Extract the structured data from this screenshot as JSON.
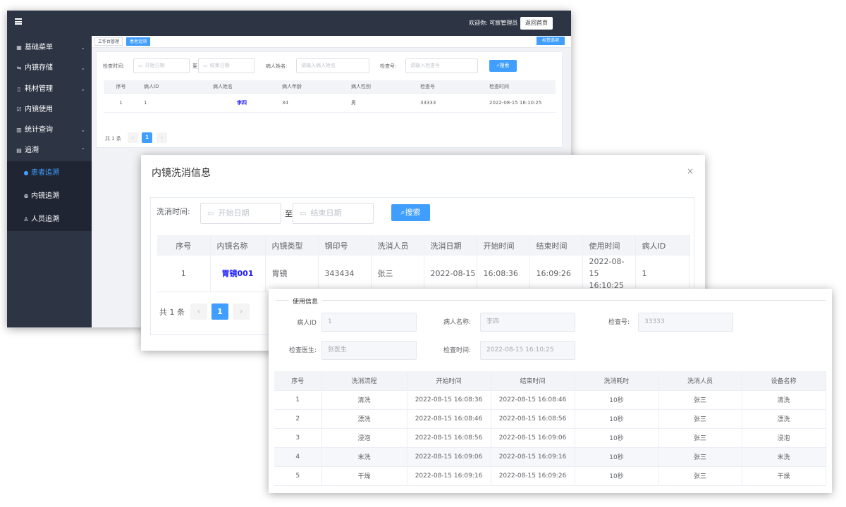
{
  "app": {
    "welcome": "欢迎你:  可宸管理员",
    "home_button": "返回首页",
    "sidebar": {
      "items": [
        {
          "label": "基础菜单",
          "icon": "grid-icon",
          "glyph": "▦",
          "chevron": "⌄"
        },
        {
          "label": "内镜存储",
          "icon": "swap-icon",
          "glyph": "⇋",
          "chevron": "⌄"
        },
        {
          "label": "耗材管理",
          "icon": "document-icon",
          "glyph": "▯",
          "chevron": "⌄"
        },
        {
          "label": "内镜使用",
          "icon": "checkbox-icon",
          "glyph": "☑",
          "chevron": ""
        },
        {
          "label": "统计查询",
          "icon": "bar-chart-icon",
          "glyph": "▥",
          "chevron": "⌄"
        },
        {
          "label": "追溯",
          "icon": "trace-icon",
          "glyph": "▤",
          "chevron": "⌃"
        }
      ],
      "sub_items": [
        {
          "label": "患者追溯",
          "icon": "person-icon",
          "glyph": "●",
          "active": true
        },
        {
          "label": "内镜追溯",
          "icon": "plus-circle-icon",
          "glyph": "⊕",
          "active": false
        },
        {
          "label": "人员追溯",
          "icon": "user-outline-icon",
          "glyph": "♙",
          "active": false
        }
      ]
    },
    "tags": {
      "workbench": "工作台管理",
      "current": "患者追溯",
      "options": "标签选项"
    },
    "filters": {
      "check_time_label": "检查时间:",
      "start_placeholder": "开始日期",
      "to": "至",
      "end_placeholder": "结束日期",
      "patient_name_label": "病人姓名:",
      "patient_name_placeholder": "请输入病人姓名",
      "check_no_label": "检查号:",
      "check_no_placeholder": "请输入检查号",
      "search": "搜索"
    },
    "table": {
      "headers": [
        "序号",
        "病人ID",
        "病人姓名",
        "病人年龄",
        "病人性别",
        "检查号",
        "检查时间"
      ],
      "rows": [
        [
          "1",
          "1",
          "李四",
          "34",
          "男",
          "33333",
          "2022-08-15 16:10:25"
        ]
      ]
    },
    "pagination": {
      "total": "共 1 条",
      "prev": "‹",
      "current": "1",
      "next": "›"
    }
  },
  "dialog": {
    "title": "内镜洗消信息",
    "close": "×",
    "filters": {
      "wash_time_label": "洗消时间:",
      "start_placeholder": "开始日期",
      "to": "至",
      "end_placeholder": "结束日期",
      "search": "搜索"
    },
    "table": {
      "headers": [
        "序号",
        "内镜名称",
        "内镜类型",
        "钢印号",
        "洗消人员",
        "洗消日期",
        "开始时间",
        "结束时间",
        "使用时间",
        "病人ID"
      ],
      "rows": [
        [
          "1",
          "胃镜001",
          "胃镜",
          "343434",
          "张三",
          "2022-08-15",
          "16:08:36",
          "16:09:26",
          "2022-08-15 16:10:25",
          "1"
        ]
      ]
    },
    "pagination": {
      "total": "共 1 条",
      "prev": "‹",
      "current": "1",
      "next": "›"
    }
  },
  "usage": {
    "legend": "使用信息",
    "fields": {
      "patient_id_label": "病人ID",
      "patient_id": "1",
      "patient_name_label": "病人名称:",
      "patient_name": "李四",
      "check_no_label": "检查号:",
      "check_no": "33333",
      "doctor_label": "检查医生:",
      "doctor": "张医生",
      "check_time_label": "检查时间:",
      "check_time": "2022-08-15 16:10:25"
    },
    "table": {
      "headers": [
        "序号",
        "洗消流程",
        "开始时间",
        "结束时间",
        "洗消耗时",
        "洗消人员",
        "设备名称"
      ],
      "rows": [
        [
          "1",
          "清洗",
          "2022-08-15 16:08:36",
          "2022-08-15 16:08:46",
          "10秒",
          "张三",
          "清洗"
        ],
        [
          "2",
          "漂洗",
          "2022-08-15 16:08:46",
          "2022-08-15 16:08:56",
          "10秒",
          "张三",
          "漂洗"
        ],
        [
          "3",
          "浸泡",
          "2022-08-15 16:08:56",
          "2022-08-15 16:09:06",
          "10秒",
          "张三",
          "浸泡"
        ],
        [
          "4",
          "末洗",
          "2022-08-15 16:09:06",
          "2022-08-15 16:09:16",
          "10秒",
          "张三",
          "末洗"
        ],
        [
          "5",
          "干燥",
          "2022-08-15 16:09:16",
          "2022-08-15 16:09:26",
          "10秒",
          "张三",
          "干燥"
        ]
      ]
    }
  },
  "colors": {
    "primary": "#409eff",
    "sidebar": "#2d3444",
    "submenu": "#1f2533",
    "link": "#1a1aff"
  }
}
